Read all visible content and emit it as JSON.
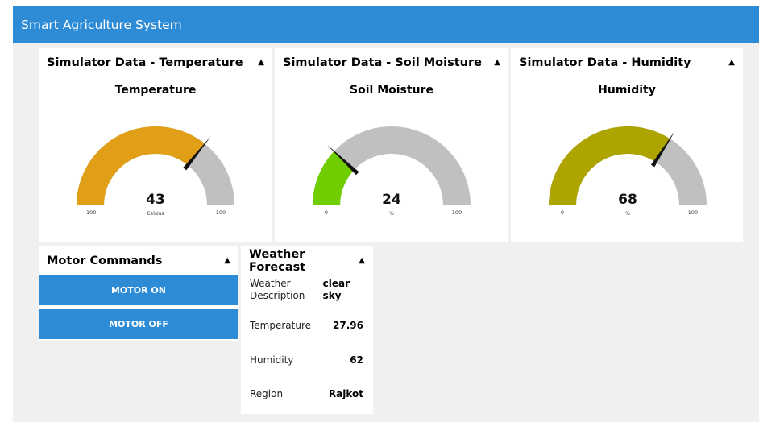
{
  "header": {
    "title": "Smart Agriculture System"
  },
  "gauges": [
    {
      "panel_title": "Simulator Data - Temperature",
      "gauge_title": "Temperature",
      "value": 43,
      "unit": "Celsius",
      "min": -100,
      "max": 100,
      "min_label": "-100",
      "max_label": "100",
      "value_label": "43",
      "color": "#e19f17"
    },
    {
      "panel_title": "Simulator Data - Soil Moisture",
      "gauge_title": "Soil Moisture",
      "value": 24,
      "unit": "%",
      "min": 0,
      "max": 100,
      "min_label": "0",
      "max_label": "100",
      "value_label": "24",
      "color": "#6fcd00"
    },
    {
      "panel_title": "Simulator Data - Humidity",
      "gauge_title": "Humidity",
      "value": 68,
      "unit": "%",
      "min": 0,
      "max": 100,
      "min_label": "0",
      "max_label": "100",
      "value_label": "68",
      "color": "#ada400"
    }
  ],
  "gauge_track_color": "#c0c0c0",
  "motor": {
    "title": "Motor Commands",
    "on_label": "MOTOR ON",
    "off_label": "MOTOR OFF"
  },
  "weather": {
    "title": "Weather Forecast",
    "description_label_1": "Weather",
    "description_label_2": "Description",
    "description_value_1": "clear",
    "description_value_2": "sky",
    "temperature_label": "Temperature",
    "temperature_value": "27.96",
    "humidity_label": "Humidity",
    "humidity_value": "62",
    "region_label": "Region",
    "region_value": "Rajkot"
  },
  "icons": {
    "collapse": "caret-up-icon"
  }
}
